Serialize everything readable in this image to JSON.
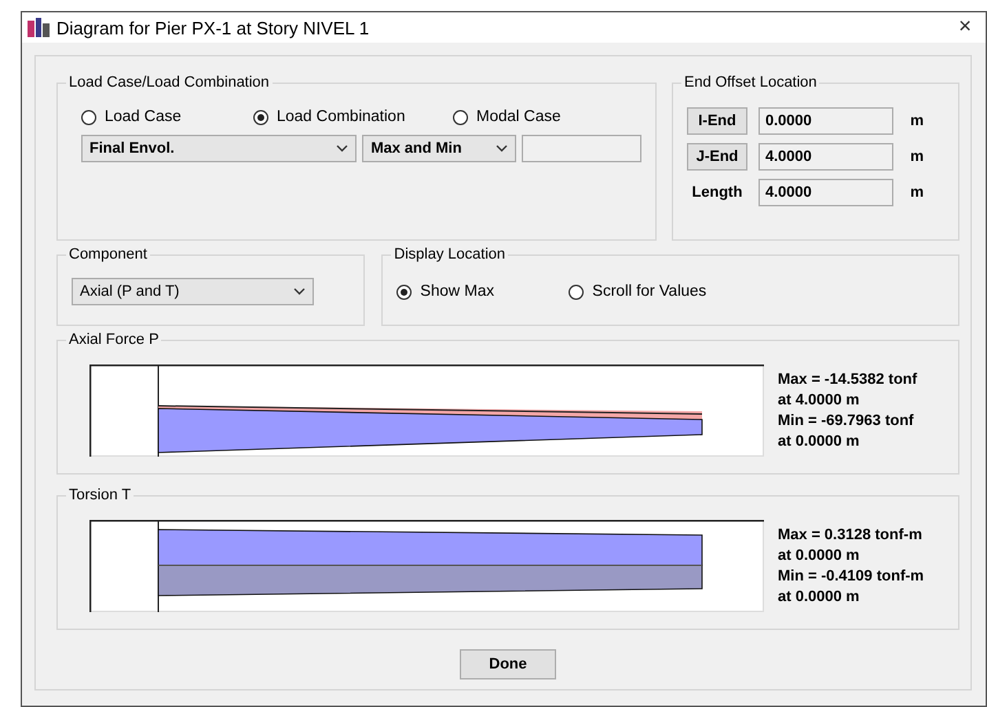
{
  "window": {
    "title": "Diagram for Pier PX-1 at Story NIVEL 1",
    "close": "×"
  },
  "load_type": {
    "title": "Load Case/Load Combination",
    "options": [
      {
        "label": "Load Case",
        "selected": false
      },
      {
        "label": "Load Combination",
        "selected": true
      },
      {
        "label": "Modal Case",
        "selected": false
      }
    ],
    "case_select": {
      "value": "Final Envol."
    },
    "mode_select": {
      "value": "Max and Min"
    }
  },
  "end_offset": {
    "title": "End Offset Location",
    "rows": [
      {
        "kind": "button",
        "label": "I-End",
        "value": "0.0000",
        "unit": "m"
      },
      {
        "kind": "button",
        "label": "J-End",
        "value": "4.0000",
        "unit": "m"
      },
      {
        "kind": "label",
        "label": "Length",
        "value": "4.0000",
        "unit": "m"
      }
    ]
  },
  "component": {
    "title": "Component",
    "value": "Axial (P and T)"
  },
  "display_location": {
    "title": "Display Location",
    "options": [
      {
        "label": "Show Max",
        "selected": true
      },
      {
        "label": "Scroll for Values",
        "selected": false
      }
    ]
  },
  "diagrams": [
    {
      "title": "Axial Force P",
      "kind": "axial",
      "lines": [
        "Max = -14.5382 tonf",
        "at 4.0000 m",
        "Min = -69.7963 tonf",
        "at 0.0000 m"
      ]
    },
    {
      "title": "Torsion T",
      "kind": "torsion",
      "lines": [
        "Max = 0.3128 tonf-m",
        "at 0.0000 m",
        "Min = -0.4109 tonf-m",
        "at 0.0000 m"
      ]
    }
  ],
  "buttons": [
    "Done"
  ]
}
